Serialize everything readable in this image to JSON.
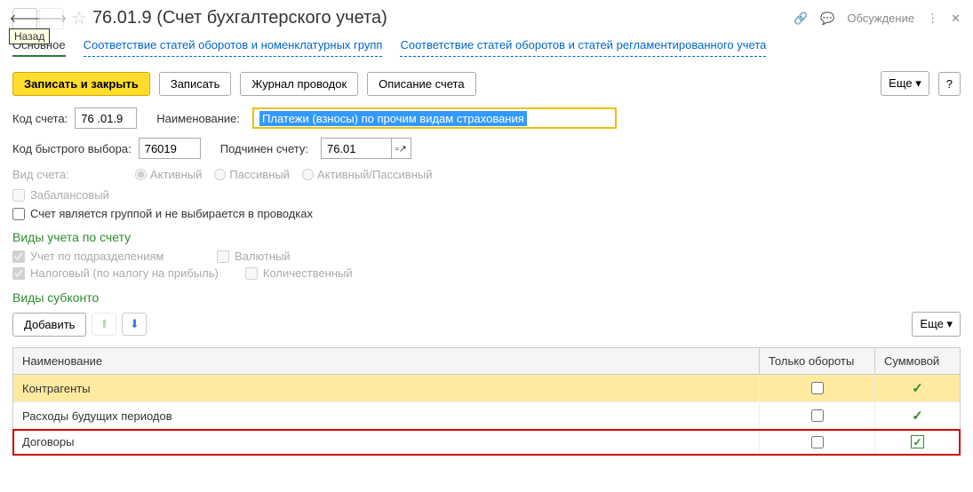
{
  "header": {
    "back_tooltip": "Назад",
    "title": "76.01.9 (Счет бухгалтерского учета)",
    "discussion": "Обсуждение"
  },
  "tabs": {
    "main": "Основное",
    "link1": "Соответствие статей оборотов и номенклатурных групп",
    "link2": "Соответствие статей оборотов и статей регламентированного учета"
  },
  "toolbar": {
    "save_close": "Записать и закрыть",
    "save": "Записать",
    "journal": "Журнал проводок",
    "description": "Описание счета",
    "more": "Еще",
    "help": "?"
  },
  "form": {
    "code_label": "Код счета:",
    "code_value": "76 .01.9",
    "name_label": "Наименование:",
    "name_value": "Платежи (взносы) по прочим видам страхования",
    "quick_label": "Код быстрого выбора:",
    "quick_value": "76019",
    "parent_label": "Подчинен счету:",
    "parent_value": "76.01",
    "kind_label": "Вид счета:",
    "kind_active": "Активный",
    "kind_passive": "Пассивный",
    "kind_both": "Активный/Пассивный",
    "offbalance": "Забалансовый",
    "is_group": "Счет является группой и не выбирается в проводках"
  },
  "sections": {
    "accounting_types": "Виды учета по счету",
    "by_dept": "Учет по подразделениям",
    "currency": "Валютный",
    "tax": "Налоговый (по налогу на прибыль)",
    "quantity": "Количественный",
    "subkonto": "Виды субконто"
  },
  "subkonto_bar": {
    "add": "Добавить",
    "more": "Еще"
  },
  "table": {
    "col_name": "Наименование",
    "col_turnover": "Только обороты",
    "col_sum": "Суммовой",
    "rows": [
      {
        "name": "Контрагенты",
        "turnover": false,
        "sum": true,
        "selected": true
      },
      {
        "name": "Расходы будущих периодов",
        "turnover": false,
        "sum": true
      },
      {
        "name": "Договоры",
        "turnover": false,
        "sum": true,
        "highlighted": true,
        "sum_boxed": true
      }
    ]
  }
}
